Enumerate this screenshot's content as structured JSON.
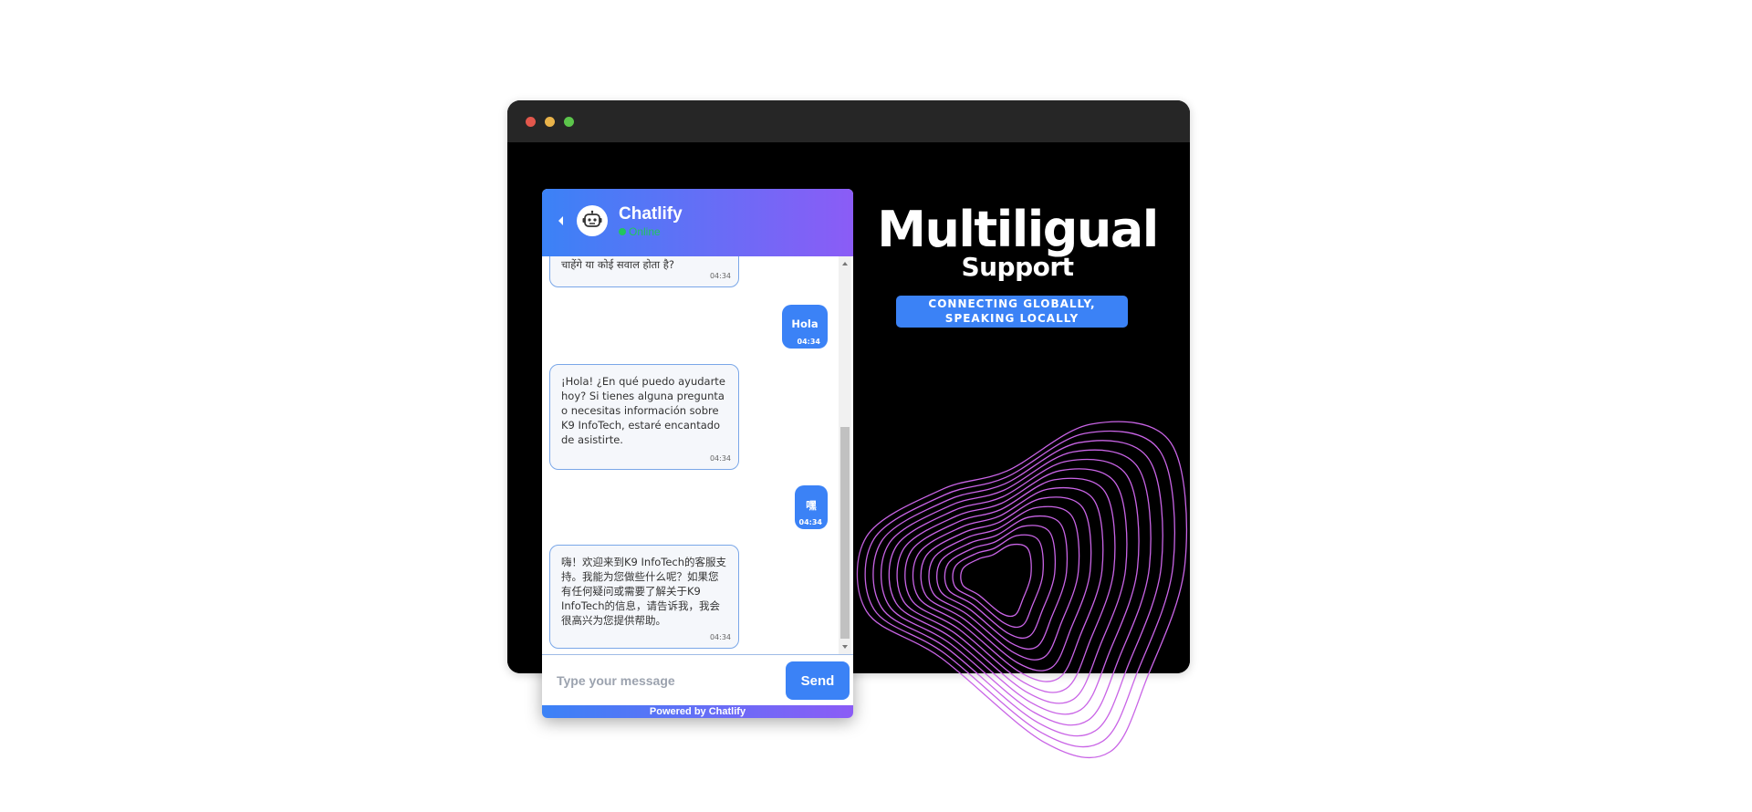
{
  "window": {
    "controls": [
      "close-dot",
      "minimize-dot",
      "maximize-dot"
    ]
  },
  "hero": {
    "title": "Multiligual",
    "subtitle": "Support",
    "tagline": "CONNECTING GLOBALLY, SPEAKING LOCALLY"
  },
  "chat": {
    "title": "Chatlify",
    "status": "Online",
    "messages": [
      {
        "sender": "bot",
        "text": "चाहेंगे या कोई सवाल होता है?",
        "time": "04:34"
      },
      {
        "sender": "user",
        "text": "Hola",
        "time": "04:34"
      },
      {
        "sender": "bot",
        "text": "¡Hola! ¿En qué puedo ayudarte hoy? Si tienes alguna pregunta o necesitas información sobre K9 InfoTech, estaré encantado de asistirte.",
        "time": "04:34"
      },
      {
        "sender": "user",
        "text": "嘿",
        "time": "04:34"
      },
      {
        "sender": "bot",
        "text": "嗨！欢迎来到K9 InfoTech的客服支持。我能为您做些什么呢？如果您有任何疑问或需要了解关于K9 InfoTech的信息，请告诉我，我会很高兴为您提供帮助。",
        "time": "04:34"
      }
    ],
    "input_placeholder": "Type your message",
    "send_label": "Send",
    "powered_by": "Powered by Chatlify"
  },
  "colors": {
    "accent": "#3b82f6",
    "gradient_end": "#8b5cf6",
    "online": "#22c55e",
    "waves": "#c964e6"
  },
  "icons": {
    "back": "chevron-left-icon",
    "avatar": "robot-icon"
  }
}
